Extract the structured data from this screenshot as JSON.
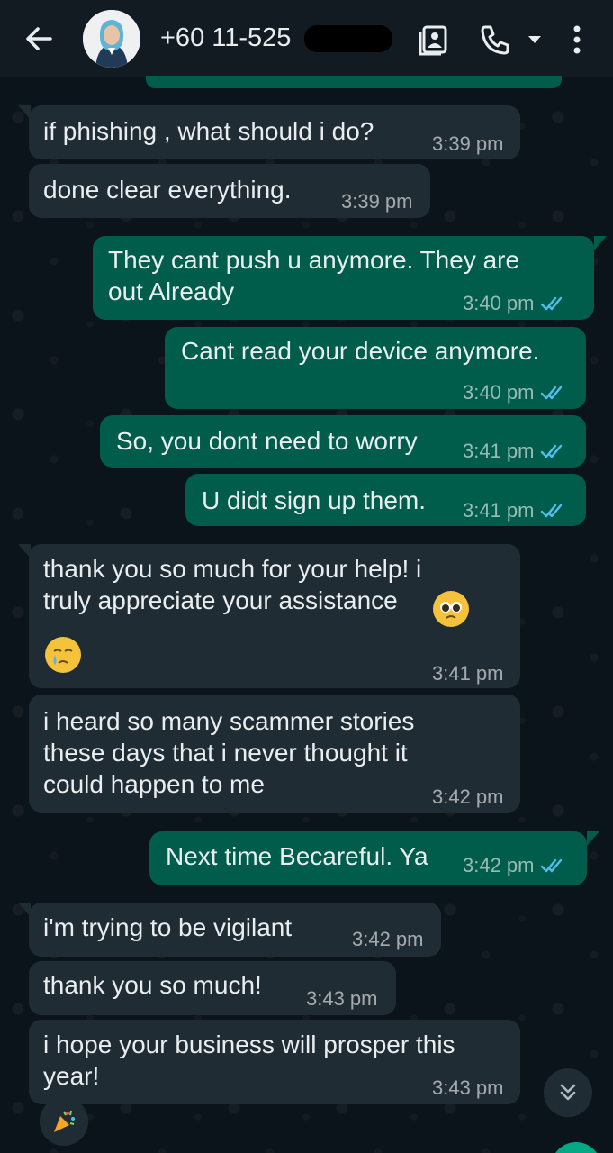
{
  "header": {
    "contact_name": "+60 11-525",
    "icons": [
      "back-arrow-icon",
      "contact-card-icon",
      "call-icon",
      "dropdown-icon",
      "menu-icon"
    ]
  },
  "messages": [
    {
      "dir": "in",
      "text": "if phishing , what should i do?",
      "time": "3:39 pm"
    },
    {
      "dir": "in",
      "text": "done clear everything.",
      "time": "3:39 pm"
    },
    {
      "dir": "out",
      "text": "They cant push u anymore. They are\nout Already",
      "time": "3:40 pm"
    },
    {
      "dir": "out",
      "text": "Cant read your device anymore.",
      "time": "3:40 pm"
    },
    {
      "dir": "out",
      "text": "So, you dont need to worry",
      "time": "3:41 pm"
    },
    {
      "dir": "out",
      "text": "U didt sign up them.",
      "time": "3:41 pm"
    },
    {
      "dir": "in",
      "text": "thank you so much for your help! i\ntruly appreciate your assistance",
      "time": "3:41 pm"
    },
    {
      "dir": "in",
      "text": "i heard so many scammer stories\nthese days that i never thought it\ncould happen to me",
      "time": "3:42 pm"
    },
    {
      "dir": "out",
      "text": "Next time Becareful. Ya",
      "time": "3:42 pm"
    },
    {
      "dir": "in",
      "text": "i'm trying to be vigilant",
      "time": "3:42 pm"
    },
    {
      "dir": "in",
      "text": "thank you so much!",
      "time": "3:43 pm"
    },
    {
      "dir": "in",
      "text": "i hope your business will prosper this\nyear!",
      "time": "3:43 pm"
    }
  ],
  "colors": {
    "incoming_bubble": "#202c33",
    "outgoing_bubble": "#005c4b",
    "read_tick": "#53bdeb",
    "background": "#0b141a"
  }
}
